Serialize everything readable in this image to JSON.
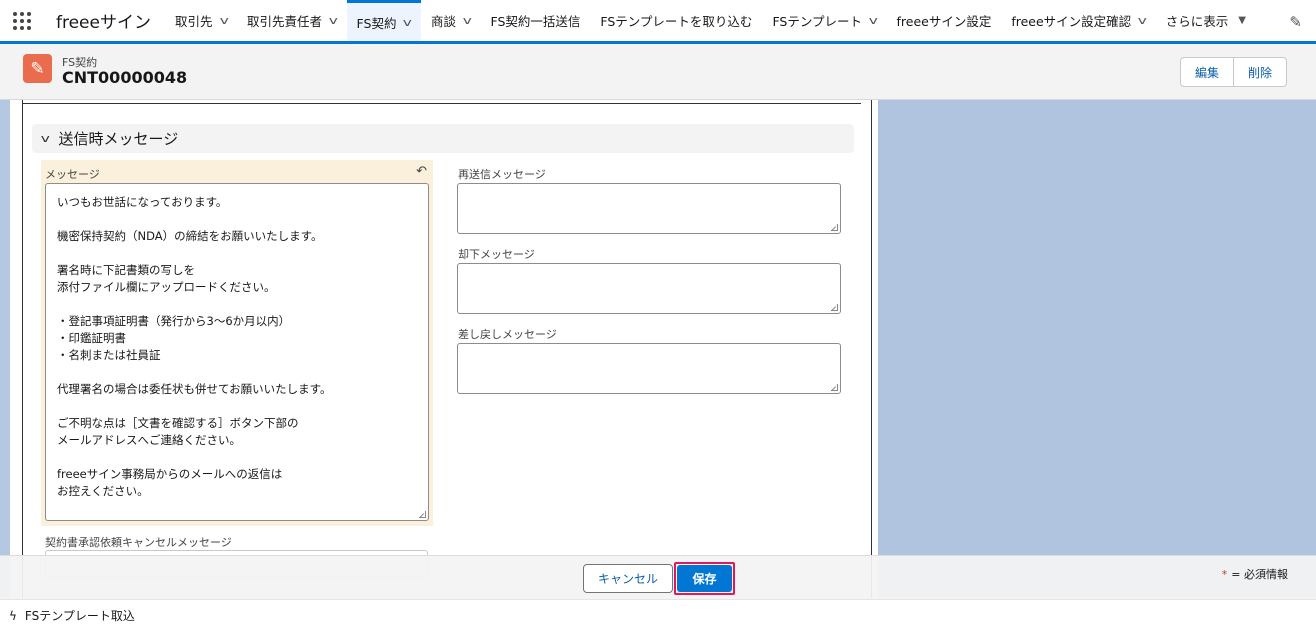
{
  "nav": {
    "app_name": "freeeサイン",
    "tabs": [
      {
        "label": "取引先",
        "dropdown": true,
        "active": false
      },
      {
        "label": "取引先責任者",
        "dropdown": true,
        "active": false
      },
      {
        "label": "FS契約",
        "dropdown": true,
        "active": true
      },
      {
        "label": "商談",
        "dropdown": true,
        "active": false
      },
      {
        "label": "FS契約一括送信",
        "dropdown": false,
        "active": false
      },
      {
        "label": "FSテンプレートを取り込む",
        "dropdown": false,
        "active": false
      },
      {
        "label": "FSテンプレート",
        "dropdown": true,
        "active": false
      },
      {
        "label": "freeeサイン設定",
        "dropdown": false,
        "active": false
      },
      {
        "label": "freeeサイン設定確認",
        "dropdown": true,
        "active": false
      }
    ],
    "more_label": "さらに表示"
  },
  "record": {
    "type_label": "FS契約",
    "name": "CNT00000048",
    "edit_label": "編集",
    "delete_label": "削除"
  },
  "section": {
    "title": "送信時メッセージ"
  },
  "fields": {
    "message_label": "メッセージ",
    "message_lines": [
      "いつもお世話になっております。",
      "",
      "機密保持契約（NDA）の締結をお願いいたします。",
      "",
      "署名時に下記書類の写しを",
      "添付ファイル欄にアップロードください。",
      "",
      "・登記事項証明書（発行から3〜6か月以内）",
      "・印鑑証明書",
      "・名刺または社員証",
      "",
      "代理署名の場合は委任状も併せてお願いいたします。",
      "",
      "ご不明な点は［文書を確認する］ボタン下部の",
      "メールアドレスへご連絡ください。",
      "",
      "freeeサイン事務局からのメールへの返信は",
      "お控えください。"
    ],
    "resend_label": "再送信メッセージ",
    "reject_label": "却下メッセージ",
    "return_label": "差し戻しメッセージ",
    "cancel_request_label": "契約書承認依頼キャンセルメッセージ"
  },
  "footer": {
    "cancel_label": "キャンセル",
    "save_label": "保存",
    "required_star": "*",
    "required_text": "= 必須情報"
  },
  "utility": {
    "label": "FSテンプレート取込"
  },
  "colors": {
    "brand_blue": "#0176d3",
    "record_icon": "#e86c4d",
    "edited_highlight": "#faf0dc",
    "save_focus_outline": "#e3185a"
  }
}
